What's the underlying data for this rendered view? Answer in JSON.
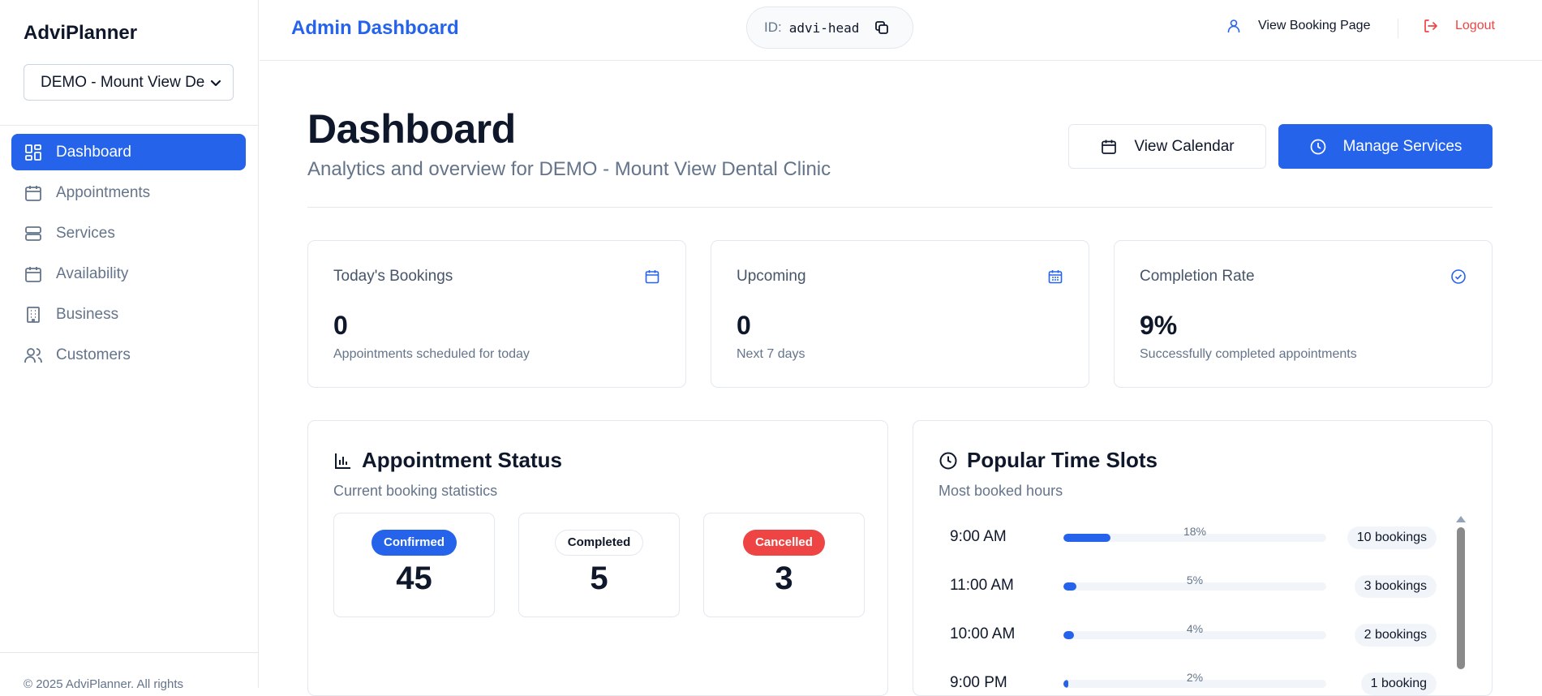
{
  "sidebar": {
    "brand": "AdviPlanner",
    "business_select": "DEMO - Mount View Der",
    "items": [
      {
        "label": "Dashboard",
        "icon": "dashboard-icon",
        "active": true
      },
      {
        "label": "Appointments",
        "icon": "calendar-icon",
        "active": false
      },
      {
        "label": "Services",
        "icon": "server-icon",
        "active": false
      },
      {
        "label": "Availability",
        "icon": "calendar-icon",
        "active": false
      },
      {
        "label": "Business",
        "icon": "building-icon",
        "active": false
      },
      {
        "label": "Customers",
        "icon": "users-icon",
        "active": false
      }
    ],
    "copyright": "© 2025 AdviPlanner. All rights"
  },
  "header": {
    "title": "Admin Dashboard",
    "id_label": "ID:",
    "id_value": "advi-head",
    "view_booking": "View Booking Page",
    "logout": "Logout"
  },
  "main": {
    "title": "Dashboard",
    "subtitle": "Analytics and overview for DEMO - Mount View Dental Clinic",
    "view_calendar": "View Calendar",
    "manage_services": "Manage Services",
    "stats": [
      {
        "label": "Today's Bookings",
        "value": "0",
        "desc": "Appointments scheduled for today",
        "icon": "calendar-icon"
      },
      {
        "label": "Upcoming",
        "value": "0",
        "desc": "Next 7 days",
        "icon": "calendar-days-icon"
      },
      {
        "label": "Completion Rate",
        "value": "9%",
        "desc": "Successfully completed appointments",
        "icon": "check-circle-icon"
      }
    ],
    "status_panel": {
      "title": "Appointment Status",
      "subtitle": "Current booking statistics",
      "cards": [
        {
          "badge": "Confirmed",
          "value": "45"
        },
        {
          "badge": "Completed",
          "value": "5"
        },
        {
          "badge": "Cancelled",
          "value": "3"
        }
      ]
    },
    "slots_panel": {
      "title": "Popular Time Slots",
      "subtitle": "Most booked hours",
      "slots": [
        {
          "time": "9:00 AM",
          "percent": "18%",
          "bookings": "10 bookings"
        },
        {
          "time": "11:00 AM",
          "percent": "5%",
          "bookings": "3 bookings"
        },
        {
          "time": "10:00 AM",
          "percent": "4%",
          "bookings": "2 bookings"
        },
        {
          "time": "9:00 PM",
          "percent": "2%",
          "bookings": "1 booking"
        }
      ]
    }
  },
  "colors": {
    "accent": "#2563eb",
    "danger": "#ef4444",
    "muted": "#64748b"
  }
}
